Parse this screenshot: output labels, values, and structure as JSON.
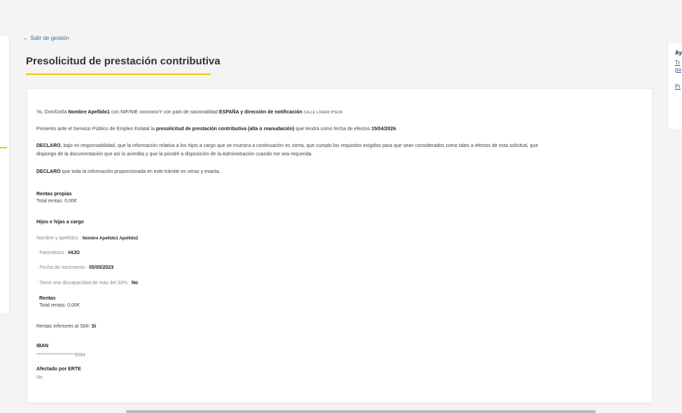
{
  "nav": {
    "back_arrow": "←",
    "back_label": "Salir de gestión"
  },
  "page": {
    "title": "Presolicitud de prestación contributiva"
  },
  "sidebar_right": {
    "title": "Ay",
    "link1_line1": "Tr",
    "link1_line2": "po",
    "link2": "Pr"
  },
  "declaration": {
    "l1_pre": "Yo, Don/Doña",
    "l1_name": "Nombre Apellido1",
    "l1_mid": "con NIF/NIE xxxxxxxxY con país de nacionalidad",
    "l1_country": "ESPAÑA y dirección de notificación",
    "l1_address": "CALLE LOREM IPSUM",
    "l2_pre": "Presento ante el Servicio Público de Empleo Estatal la",
    "l2_bold": "presolicitud de prestación contributiva (alta o reanudación)",
    "l2_mid": "que tendrá como fecha de efectos",
    "l2_date": "15/04/2026",
    "l2_end": ".",
    "l3_bold": "DECLARO",
    "l3_a": ", bajo mi responsabilidad, que la información relativa a los hijos a cargo que se muestra a continuación es cierta, que cumplo los requisitos exigidos para que sean considerados como tales a efectos de esta solicitud, que",
    "l3_b": "dispongo de la documentación que así lo acredita y que la pondré a disposición de la Administración cuando me sea requerida.",
    "l4_bold": "DECLARO",
    "l4_rest": "que toda la información proporcionada en este trámite es veraz y exacta."
  },
  "rentas_propias": {
    "heading": "Rentas propias",
    "total_label": "Total rentas: 0,00€"
  },
  "hijos": {
    "heading": "Hijos e hijas a cargo",
    "name_label": "Nombre y apellidos :",
    "name_value": "Nombre Apellido1 Apellido2",
    "parentesco_label": "· Parentesco :",
    "parentesco_value": "HIJO",
    "fecha_label": "· Fecha de nacimiento :",
    "fecha_value": "05/05/2023",
    "discapacidad_label": "· Tiene una discapacidad de más del 33% :",
    "discapacidad_value": "No",
    "rentas_heading": "Rentas",
    "rentas_total": "Total rentas: 0,00€"
  },
  "smi": {
    "label": "Rentas inferiores al SMI:",
    "value": "Sí"
  },
  "iban": {
    "heading": "IBAN",
    "value": "********************8584"
  },
  "erte": {
    "heading": "Afectado por ERTE",
    "value": "No"
  }
}
